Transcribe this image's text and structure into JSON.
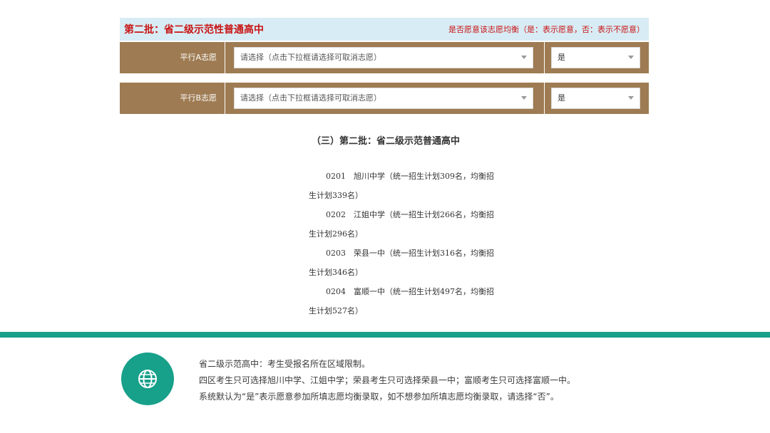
{
  "form": {
    "title": "第二批：省二级示范性普通高中",
    "note": "是否愿意该志愿均衡（是：表示愿意，否：表示不愿意）",
    "rows": [
      {
        "label": "平行A志愿",
        "placeholder": "请选择（点击下拉框请选择可取消志愿）",
        "balance": "是"
      },
      {
        "label": "平行B志愿",
        "placeholder": "请选择（点击下拉框请选择可取消志愿）",
        "balance": "是"
      }
    ]
  },
  "doc": {
    "heading": "（三）第二批：省二级示范普通高中",
    "lines": [
      "0201　旭川中学（统一招生计划309名，均衡招",
      "生计划339名）",
      "0202　江姐中学（统一招生计划266名，均衡招",
      "生计划296名）",
      "0203　荣县一中（统一招生计划316名，均衡招",
      "生计划346名）",
      "0204　富顺一中（统一招生计划497名，均衡招",
      "生计划527名）"
    ]
  },
  "notes": {
    "icon": "globe-icon",
    "lines": [
      "省二级示范高中：考生受报名所在区域限制。",
      "四区考生只可选择旭川中学、江姐中学；荣县考生只可选择荣县一中；富顺考生只可选择富顺一中。",
      "系统默认为“是”表示愿意参加所填志愿均衡录取，如不想参加所填志愿均衡录取，请选择“否”。"
    ]
  },
  "colors": {
    "accent": "#17a08a",
    "row_bg": "#9e7b52",
    "header_bg": "#d8ecf5",
    "title_red": "#c81414"
  }
}
